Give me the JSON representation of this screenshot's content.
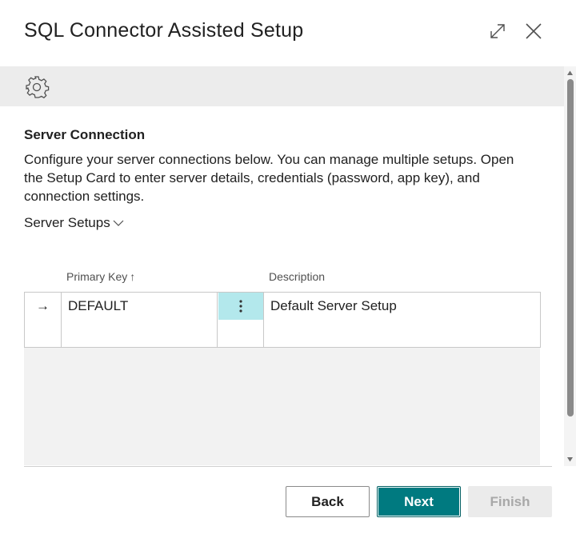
{
  "dialog": {
    "title": "SQL Connector Assisted Setup",
    "expand_icon": "expand-icon",
    "close_icon": "close-icon"
  },
  "banner": {
    "icon": "gear-icon"
  },
  "section": {
    "title": "Server Connection",
    "description": "Configure your server connections below. You can manage multiple setups. Open the Setup Card to enter server details, credentials (password, app key), and connection settings."
  },
  "part": {
    "title": "Server Setups"
  },
  "grid": {
    "columns": {
      "primary_key": "Primary Key",
      "description": "Description"
    },
    "sort_indicator": "↑",
    "rows": [
      {
        "selected_marker": "→",
        "primary_key": "DEFAULT",
        "description": "Default Server Setup"
      },
      {
        "selected_marker": "",
        "primary_key": "",
        "description": ""
      }
    ]
  },
  "footer": {
    "back": "Back",
    "next": "Next",
    "finish": "Finish"
  },
  "colors": {
    "accent": "#007a80",
    "active_cell": "#b3e8ec",
    "banner": "#ececec"
  }
}
